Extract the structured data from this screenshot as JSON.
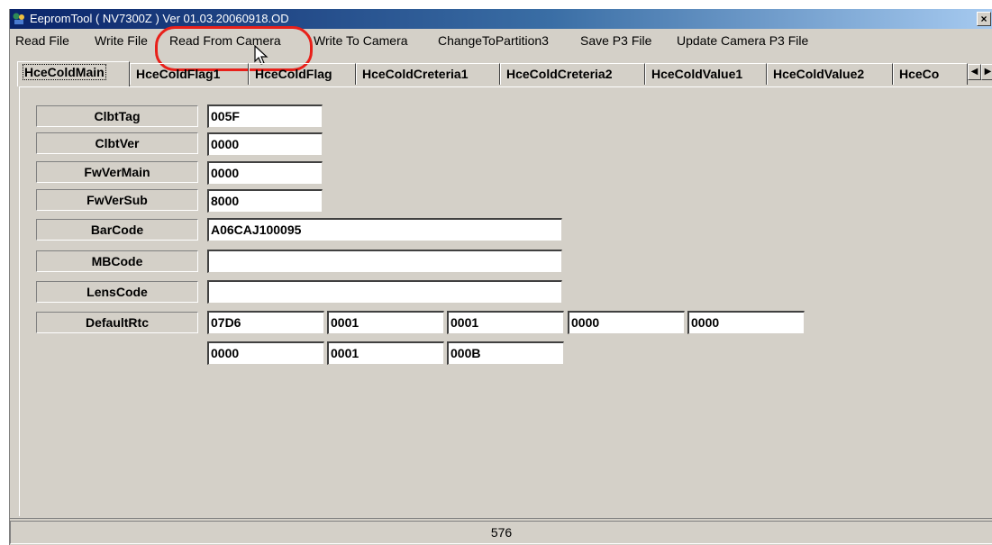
{
  "window": {
    "title": "EepromTool ( NV7300Z ) Ver 01.03.20060918.OD",
    "close_label": "×"
  },
  "menu": [
    "Read File",
    "Write File",
    "Read From Camera",
    "Write To Camera",
    "ChangeToPartition3",
    "Save P3 File",
    "Update Camera P3 File"
  ],
  "tabs": [
    "HceColdMain",
    "HceColdFlag1",
    "HceColdFlag",
    "HceColdCreteria1",
    "HceColdCreteria2",
    "HceColdValue1",
    "HceColdValue2",
    "HceCo"
  ],
  "active_tab_index": 0,
  "tab_scroll": {
    "left": "◀",
    "right": "▶"
  },
  "fields": [
    {
      "label": "ClbtTag",
      "values": [
        "005F"
      ]
    },
    {
      "label": "ClbtVer",
      "values": [
        "0000"
      ]
    },
    {
      "label": "FwVerMain",
      "values": [
        "0000"
      ]
    },
    {
      "label": "FwVerSub",
      "values": [
        "8000"
      ]
    },
    {
      "label": "BarCode",
      "values": [
        "A06CAJ100095"
      ]
    },
    {
      "label": "MBCode",
      "values": [
        ""
      ]
    },
    {
      "label": "LensCode",
      "values": [
        ""
      ]
    },
    {
      "label": "DefaultRtc",
      "values": [
        "07D6",
        "0001",
        "0001",
        "0000",
        "0000",
        "0000",
        "0001",
        "000B"
      ]
    }
  ],
  "status": {
    "value": "576"
  },
  "annotation": {
    "highlight_color": "#e8201a"
  }
}
